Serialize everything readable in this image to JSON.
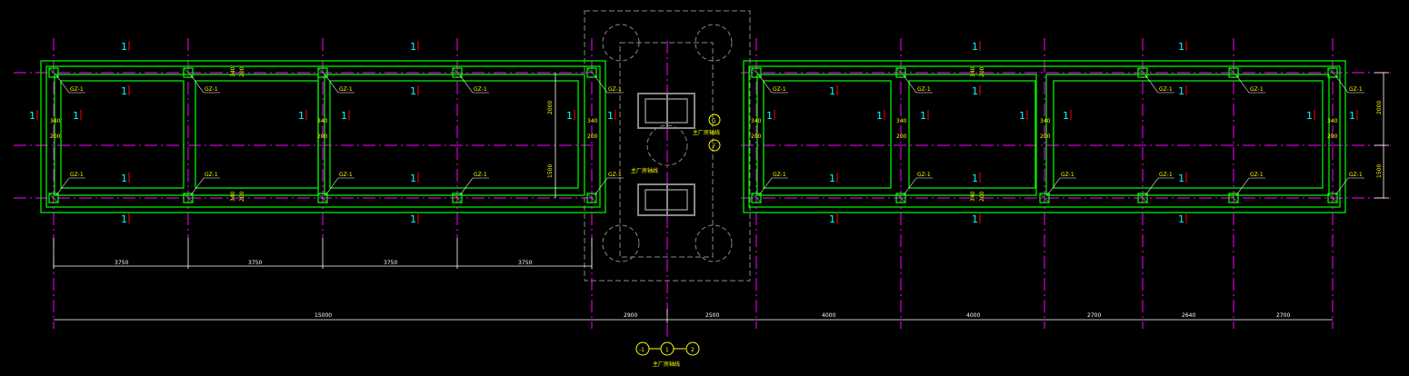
{
  "drawing": {
    "colors": {
      "background": "#000000",
      "beam": "#00ff00",
      "axis": "#ff00ff",
      "dimension": "#ffffff",
      "label": "#ffff00",
      "section_number": "#00ffff",
      "section_tick": "#ff0000",
      "equipment": "#888888"
    },
    "column_tag": "GZ-1",
    "section_mark": "1",
    "dimension_labels": {
      "beam_340": "340",
      "beam_200": "200",
      "height_2000_left": "2000",
      "height_1500_left": "1500",
      "height_2000_right": "2000",
      "height_1500_right": "1500"
    },
    "equipment_label": "主厂房轴线",
    "axis_bubbles": [
      {
        "id": "-1",
        "text": "-1"
      },
      {
        "id": "1",
        "text": "1"
      },
      {
        "id": "2",
        "text": "2"
      }
    ],
    "side_bubbles": [
      {
        "text": "G"
      },
      {
        "text": "F"
      }
    ],
    "bottom_caption": "主厂房轴线",
    "dimensions_row1": [
      {
        "text": "3750"
      },
      {
        "text": "3750"
      },
      {
        "text": "3750"
      },
      {
        "text": "3750"
      }
    ],
    "dimensions_row2": [
      {
        "text": "15000"
      },
      {
        "text": "2900"
      },
      {
        "text": "2500"
      },
      {
        "text": "4000"
      },
      {
        "text": "4000"
      },
      {
        "text": "2700"
      },
      {
        "text": "2640"
      },
      {
        "text": "2700"
      }
    ]
  }
}
